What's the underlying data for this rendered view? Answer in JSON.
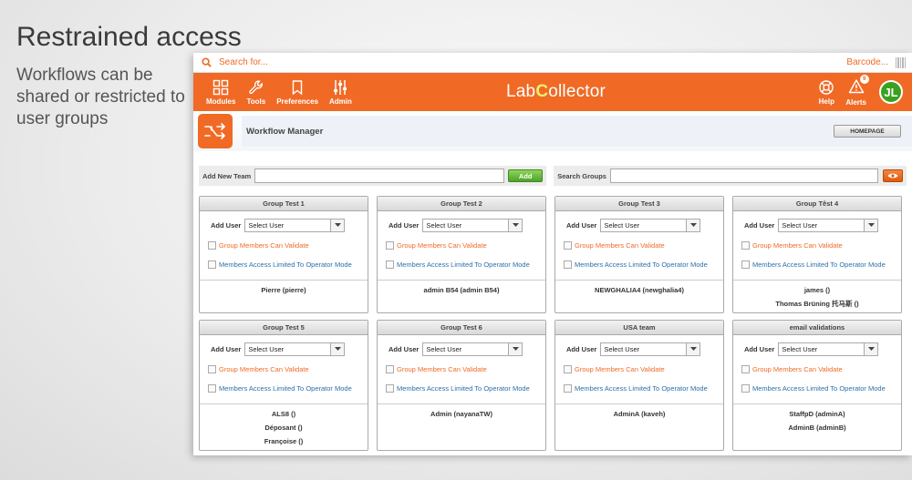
{
  "promo": {
    "title": "Restrained access",
    "subtitle": "Workflows can be shared or restricted to user groups"
  },
  "search": {
    "placeholder": "Search for...",
    "barcode_label": "Barcode..."
  },
  "nav": {
    "items": [
      {
        "label": "Modules",
        "icon": "modules-icon"
      },
      {
        "label": "Tools",
        "icon": "wrench-icon"
      },
      {
        "label": "Preferences",
        "icon": "bookmark-icon"
      },
      {
        "label": "Admin",
        "icon": "sliders-icon"
      }
    ],
    "logo": {
      "prefix": "Lab",
      "accent": "C",
      "suffix": "ollector"
    },
    "help_label": "Help",
    "alerts_label": "Alerts",
    "alerts_count": "9",
    "avatar_initials": "JL"
  },
  "header": {
    "title": "Workflow Manager",
    "homepage_button": "HOMEPAGE"
  },
  "toolbar": {
    "add_team_label": "Add New Team",
    "add_button": "Add",
    "search_groups_label": "Search Groups"
  },
  "groups": [
    {
      "name": "Group Test 1",
      "add_user": "Add User",
      "select": "Select User",
      "validate": "Group Members Can Validate",
      "operator": "Members Access Limited To Operator Mode",
      "members": [
        "Pierre (pierre)"
      ]
    },
    {
      "name": "Group Test 2",
      "add_user": "Add User",
      "select": "Select User",
      "validate": "Group Members Can Validate",
      "operator": "Members Access Limited To Operator Mode",
      "members": [
        "admin B54 (admin B54)"
      ]
    },
    {
      "name": "Group Test 3",
      "add_user": "Add User",
      "select": "Select User",
      "validate": "Group Members Can Validate",
      "operator": "Members Access Limited To Operator Mode",
      "members": [
        "NEWGHALIA4 (newghalia4)"
      ]
    },
    {
      "name": "Group Têst 4",
      "add_user": "Add User",
      "select": "Select User",
      "validate": "Group Members Can Validate",
      "operator": "Members Access Limited To Operator Mode",
      "members": [
        "james ()",
        "Thomas Brüning 托马斯 ()"
      ]
    },
    {
      "name": "Group Test 5",
      "add_user": "Add User",
      "select": "Select User",
      "validate": "Group Members Can Validate",
      "operator": "Members Access Limited To Operator Mode",
      "members": [
        "ALS8 ()",
        "Déposant ()",
        "Françoise ()"
      ]
    },
    {
      "name": "Group Test 6",
      "add_user": "Add User",
      "select": "Select User",
      "validate": "Group Members Can Validate",
      "operator": "Members Access Limited To Operator Mode",
      "members": [
        "Admin (nayanaTW)"
      ]
    },
    {
      "name": "USA team",
      "add_user": "Add User",
      "select": "Select User",
      "validate": "Group Members Can Validate",
      "operator": "Members Access Limited To Operator Mode",
      "members": [
        "AdminA (kaveh)"
      ]
    },
    {
      "name": "email validations",
      "add_user": "Add User",
      "select": "Select User",
      "validate": "Group Members Can Validate",
      "operator": "Members Access Limited To Operator Mode",
      "members": [
        "StaffpD (adminA)",
        "AdminB (adminB)"
      ]
    }
  ],
  "colors": {
    "accent": "#f06a25",
    "link_blue": "#2d6fa8",
    "add_green": "#5cb234",
    "avatar_green": "#3aa11e"
  }
}
